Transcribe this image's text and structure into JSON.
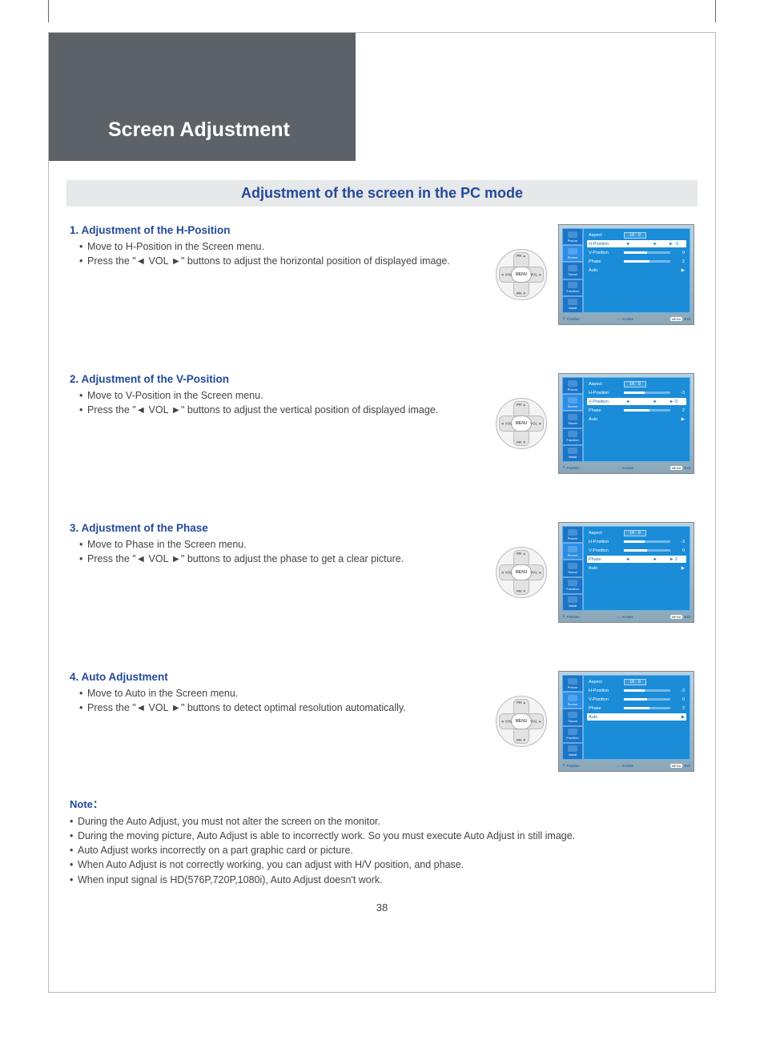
{
  "header": {
    "title": "Screen Adjustment",
    "subtitle": "Adjustment of the screen in the PC mode"
  },
  "sections": [
    {
      "title": "1. Adjustment of the H-Position",
      "bullets": [
        "Move to H-Position in the Screen menu.",
        "Press the \"◄ VOL ►\" buttons to adjust the horizontal position of displayed image."
      ],
      "highlight": "H-Position"
    },
    {
      "title": "2. Adjustment of the V-Position",
      "bullets": [
        "Move to V-Position in the Screen menu.",
        "Press the \"◄ VOL ►\" buttons to adjust the vertical position of displayed image."
      ],
      "highlight": "V-Position"
    },
    {
      "title": "3. Adjustment of the Phase",
      "bullets": [
        "Move to Phase in the Screen menu.",
        "Press the \"◄ VOL ►\" buttons to adjust the phase to get a clear picture."
      ],
      "highlight": "Phase"
    },
    {
      "title": "4. Auto Adjustment",
      "bullets": [
        "Move to Auto in the Screen menu.",
        "Press the \"◄ VOL ►\" buttons to detect optimal resolution automatically."
      ],
      "highlight": "Auto"
    }
  ],
  "remote": {
    "center": "MENU",
    "up": "PR ▲",
    "down": "PR ▼",
    "left": "◄ VOL",
    "right": "VOL ►"
  },
  "osd": {
    "tabs": [
      "Picture",
      "Screen",
      "Sound",
      "Function",
      "Install"
    ],
    "activeTab": "Screen",
    "rows": [
      {
        "name": "Aspect",
        "value": "16 : 9",
        "type": "box"
      },
      {
        "name": "H-Position",
        "value": "-3",
        "type": "slider",
        "fill": 45
      },
      {
        "name": "V-Position",
        "value": "0",
        "type": "slider",
        "fill": 50
      },
      {
        "name": "Phase",
        "value": "2",
        "type": "slider",
        "fill": 55
      },
      {
        "name": "Auto",
        "value": "▶",
        "type": "arrow"
      }
    ],
    "footer": {
      "position": "Position",
      "access": "Access",
      "exit": "Exit",
      "exitPill": "MENU"
    }
  },
  "notes": {
    "title": "Note：",
    "items": [
      "During the Auto Adjust, you must not alter the screen on the monitor.",
      "During the moving picture, Auto Adjust is able to incorrectly work. So you must execute Auto Adjust in still image.",
      "Auto Adjust works incorrectly on a part graphic card or picture.",
      "When Auto Adjust is not correctly working, you can adjust with H/V position, and phase.",
      "When input signal is HD(576P,720P,1080i), Auto Adjust doesn't work."
    ]
  },
  "pageNumber": "38"
}
